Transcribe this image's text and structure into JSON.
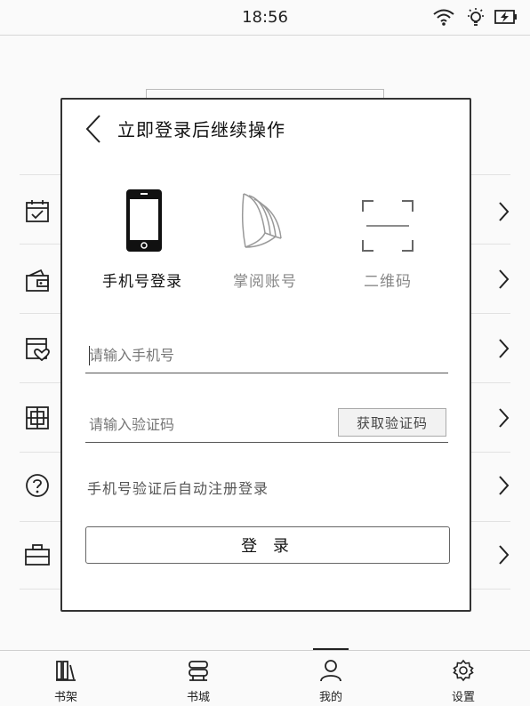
{
  "status_bar": {
    "time": "18:56",
    "icons": [
      "wifi-icon",
      "frontlight-icon",
      "battery-charging-icon"
    ]
  },
  "background_list": {
    "row_icons": [
      "calendar-check-icon",
      "wallet-icon",
      "favorites-icon",
      "grid-box-icon",
      "help-circle-icon",
      "briefcase-icon"
    ]
  },
  "bottom_nav": {
    "items": [
      {
        "label": "书架",
        "icon": "bookshelf-icon"
      },
      {
        "label": "书城",
        "icon": "bookstore-icon"
      },
      {
        "label": "我的",
        "icon": "user-icon",
        "active": true
      },
      {
        "label": "设置",
        "icon": "settings-icon"
      }
    ]
  },
  "dialog": {
    "title": "立即登录后继续操作",
    "methods": [
      {
        "label": "手机号登录",
        "icon": "phone-icon",
        "selected": true
      },
      {
        "label": "掌阅账号",
        "icon": "book-pages-icon",
        "selected": false
      },
      {
        "label": "二维码",
        "icon": "qr-scan-icon",
        "selected": false
      }
    ],
    "phone_input": {
      "placeholder": "请输入手机号",
      "value": ""
    },
    "code_input": {
      "placeholder": "请输入验证码",
      "value": ""
    },
    "get_code_label": "获取验证码",
    "hint": "手机号验证后自动注册登录",
    "login_label": "登 录"
  },
  "colors": {
    "text": "#222222",
    "muted": "#888888",
    "border": "#333333",
    "background": "#fafafa"
  }
}
